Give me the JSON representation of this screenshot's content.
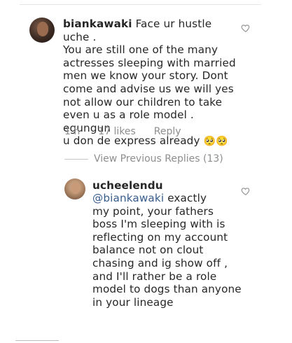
{
  "comments": [
    {
      "username": "biankawaki",
      "text": "Face ur hustle uche .\nYou are still one of the many\nactresses sleeping with married\nmen we know your story. Dont\ncome and advise us we will yes\nnot allow our children to take\neven u as a role model . egungun\nu don de express already",
      "emoji": "🥺🥺",
      "time": "1 h",
      "likes": "17 likes",
      "reply_label": "Reply",
      "like_icon": "heart-outline-icon"
    }
  ],
  "view_replies": "View Previous Replies (13)",
  "reply": {
    "username": "ucheelendu",
    "mention": "@biankawaki",
    "text_first": " exactly",
    "text_rest": "my point, your fathers\nboss I'm sleeping with is\nreflecting on my account\nbalance not on clout\nchasing and ig show off ,\nand I'll rather be a role\nmodel to dogs than anyone\nin your lineage",
    "like_icon": "heart-outline-icon"
  },
  "colors": {
    "mention": "#375c8a",
    "meta": "#8e8e8e",
    "text": "#262626"
  }
}
